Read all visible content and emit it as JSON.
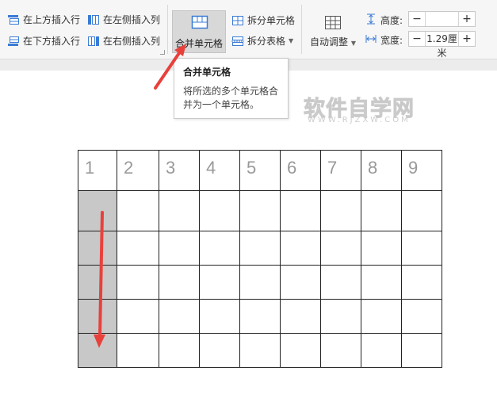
{
  "toolbar": {
    "insert_above": "在上方插入行",
    "insert_below": "在下方插入行",
    "insert_left": "在左侧插入列",
    "insert_right": "在右侧插入列",
    "merge_cells": "合并单元格",
    "split_cells": "拆分单元格",
    "split_table": "拆分表格",
    "auto_fit": "自动调整",
    "height_label": "高度:",
    "width_label": "宽度:",
    "height_value": "",
    "width_value": "1.29厘米",
    "minus": "−",
    "plus": "+"
  },
  "tooltip": {
    "title": "合并单元格",
    "body": "将所选的多个单元格合并为一个单元格。"
  },
  "watermark": {
    "main": "软件自学网",
    "sub": "WWW.RJZXW.COM"
  },
  "table": {
    "header": [
      "1",
      "2",
      "3",
      "4",
      "5",
      "6",
      "7",
      "8",
      "9"
    ],
    "body_rows": 5,
    "selected_column": 1
  },
  "colors": {
    "annotation_arrow": "#e8413c",
    "selection": "#c8c8c8"
  }
}
